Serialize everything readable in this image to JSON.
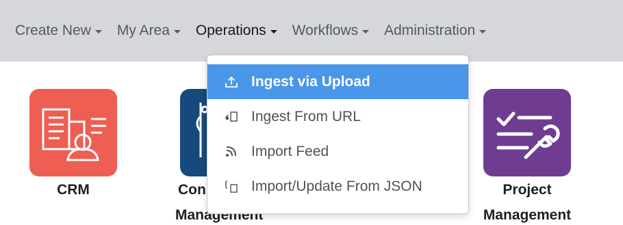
{
  "nav": {
    "items": [
      {
        "label": "Create New"
      },
      {
        "label": "My Area"
      },
      {
        "label": "Operations"
      },
      {
        "label": "Workflows"
      },
      {
        "label": "Administration"
      }
    ]
  },
  "tiles": {
    "crm": {
      "label": "CRM",
      "color": "#ee5e52"
    },
    "content": {
      "label_line1": "Con",
      "label_line2": "Management",
      "color": "#164a7c"
    },
    "project": {
      "label_line1": "Project",
      "label_line2": "Management",
      "color": "#6e3d92"
    }
  },
  "dropdown": {
    "items": [
      {
        "label": "Ingest via Upload",
        "icon": "upload-icon"
      },
      {
        "label": "Ingest From URL",
        "icon": "link-icon"
      },
      {
        "label": "Import Feed",
        "icon": "rss-icon"
      },
      {
        "label": "Import/Update From JSON",
        "icon": "json-icon"
      }
    ],
    "highlight_color": "#4a96e8"
  }
}
